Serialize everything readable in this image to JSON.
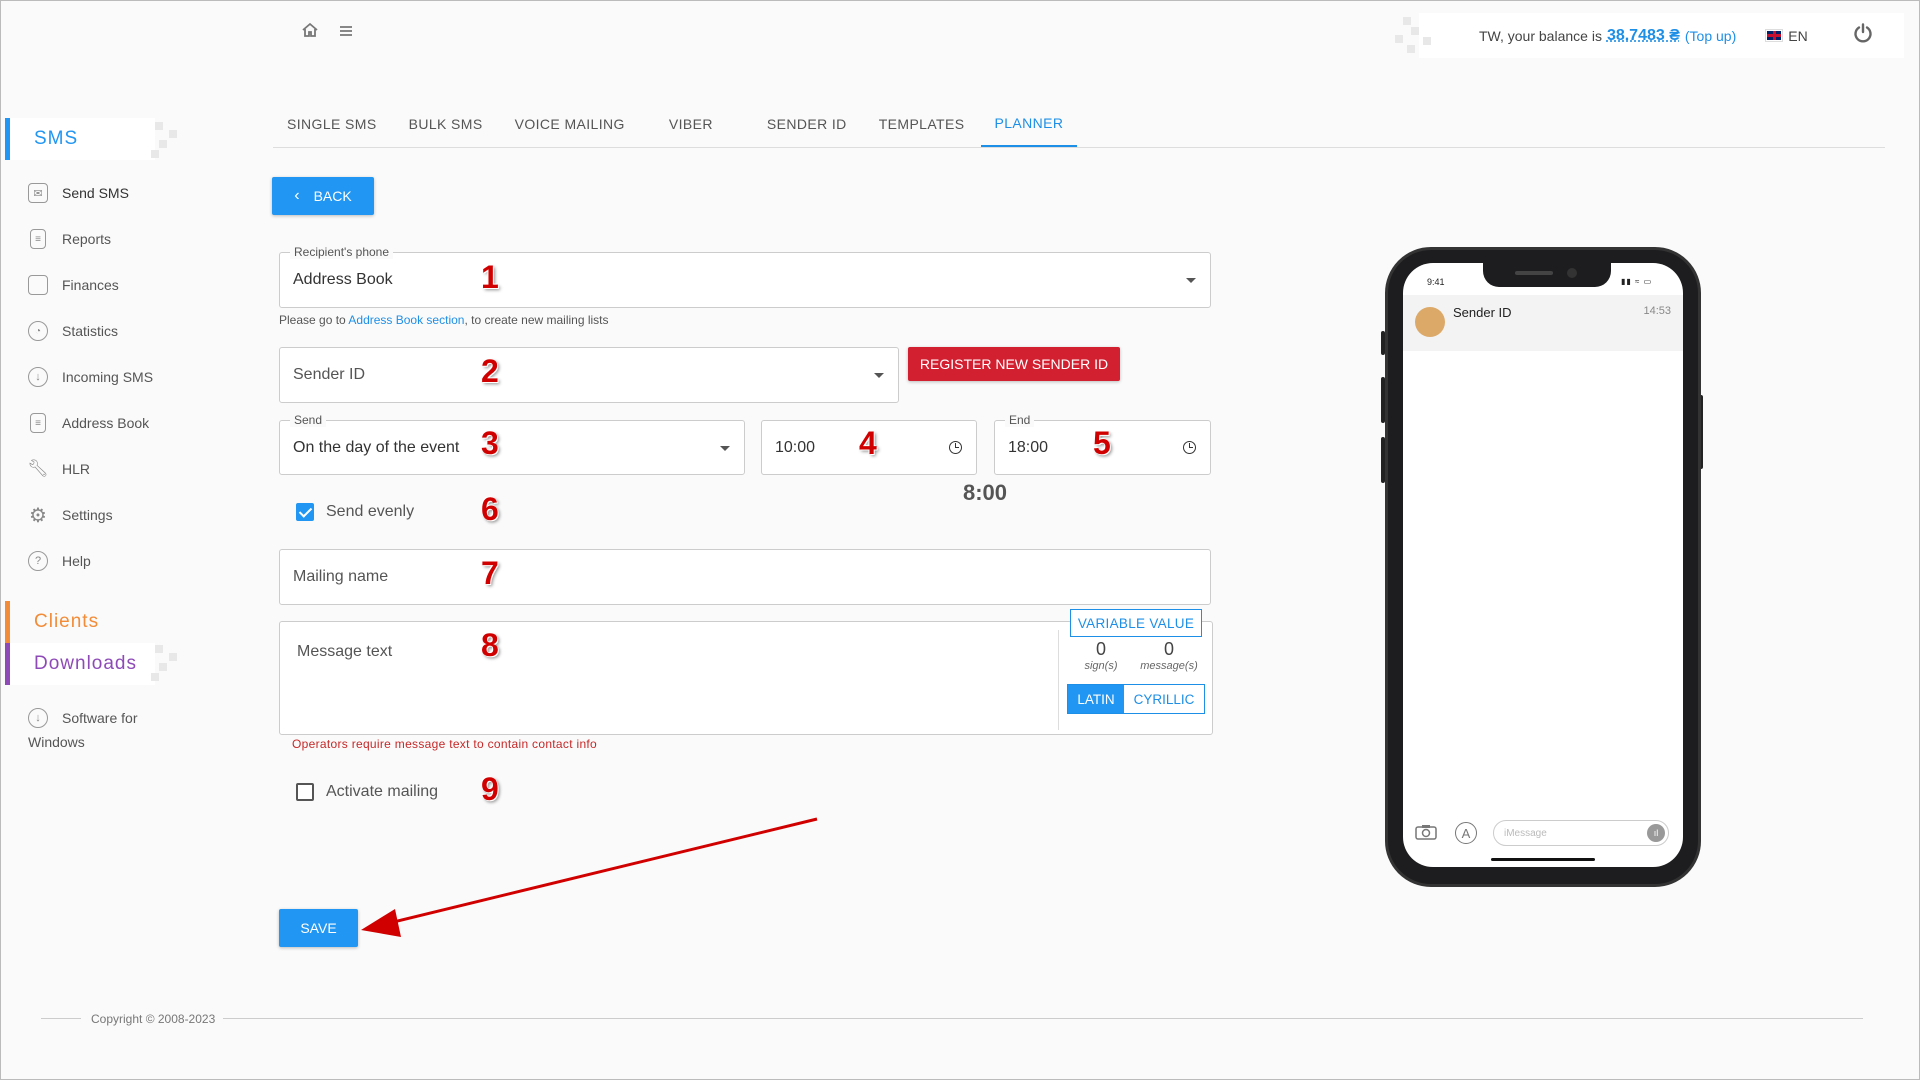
{
  "header": {
    "balance_prefix": "TW, your balance is",
    "balance_amount": "38.7483 ₴",
    "topup": "(Top up)",
    "language": "EN"
  },
  "sidebar": {
    "sms_section": "SMS",
    "items": [
      {
        "label": "Send SMS",
        "icon": "envelope-icon"
      },
      {
        "label": "Reports",
        "icon": "document-icon"
      },
      {
        "label": "Finances",
        "icon": "wallet-icon"
      },
      {
        "label": "Statistics",
        "icon": "pie-chart-icon"
      },
      {
        "label": "Incoming SMS",
        "icon": "download-icon"
      },
      {
        "label": "Address Book",
        "icon": "book-icon"
      },
      {
        "label": "HLR",
        "icon": "wrench-icon"
      },
      {
        "label": "Settings",
        "icon": "gear-icon"
      },
      {
        "label": "Help",
        "icon": "question-icon"
      }
    ],
    "clients_section": "Clients",
    "downloads_section": "Downloads",
    "software_line1": "Software for",
    "software_line2": "Windows",
    "colors": {
      "sms": "#2196f3",
      "clients": "#f28c38",
      "downloads": "#8e4bb8"
    }
  },
  "tabs": [
    {
      "label": "SINGLE SMS",
      "active": false
    },
    {
      "label": "BULK SMS",
      "active": false
    },
    {
      "label": "VOICE MAILING",
      "active": false
    },
    {
      "label": "VIBER",
      "active": false
    },
    {
      "label": "SENDER ID",
      "active": false
    },
    {
      "label": "TEMPLATES",
      "active": false
    },
    {
      "label": "PLANNER",
      "active": true
    }
  ],
  "form": {
    "back": "BACK",
    "recipient_label": "Recipient's phone",
    "recipient_value": "Address Book",
    "address_hint_pre": "Please go to",
    "address_hint_link": "Address Book section",
    "address_hint_post": ", to create new mailing lists",
    "sender_placeholder": "Sender ID",
    "register_sender": "REGISTER NEW SENDER ID",
    "send_label": "Send",
    "send_value": "On the day of the event",
    "start_time": "10:00",
    "end_label": "End",
    "end_time": "18:00",
    "duration": "8:00",
    "send_evenly": "Send evenly",
    "send_evenly_checked": true,
    "mailing_name_placeholder": "Mailing name",
    "message_placeholder": "Message text",
    "variable_value": "VARIABLE VALUE",
    "signs_count": "0",
    "signs_label": "sign(s)",
    "messages_count": "0",
    "messages_label": "message(s)",
    "latin": "LATIN",
    "cyrillic": "CYRILLIC",
    "operators_note": "Operators require message text to contain contact info",
    "activate_mailing": "Activate mailing",
    "activate_checked": false,
    "save": "SAVE"
  },
  "annotations": [
    "1",
    "2",
    "3",
    "4",
    "5",
    "6",
    "7",
    "8",
    "9"
  ],
  "phone": {
    "time": "9:41",
    "sender": "Sender ID",
    "msg_time": "14:53",
    "imessage_placeholder": "iMessage"
  },
  "footer": {
    "copyright": "Copyright © 2008-2023"
  }
}
